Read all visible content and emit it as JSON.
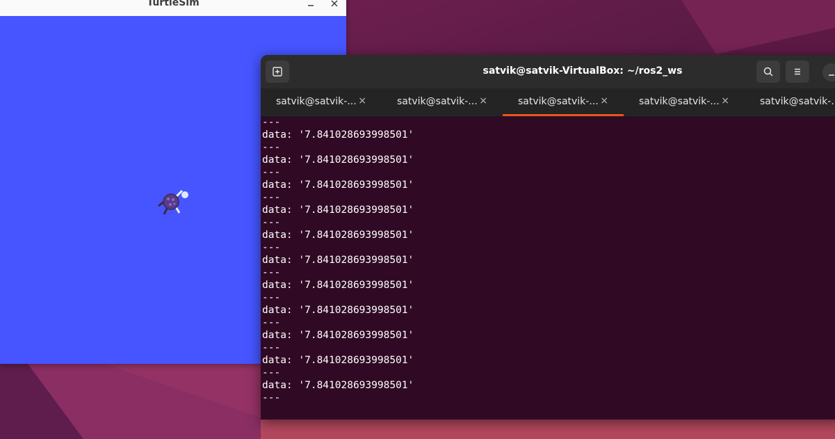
{
  "turtlesim": {
    "title": "TurtleSim",
    "minimize_icon": "minimize-icon",
    "close_icon": "close-icon",
    "background": "#4655ff"
  },
  "terminal": {
    "title": "satvik@satvik-VirtualBox: ~/ros2_ws",
    "background": "#300a24",
    "tabs": [
      {
        "label": "satvik@satvik-...",
        "active": false
      },
      {
        "label": "satvik@satvik-...",
        "active": false
      },
      {
        "label": "satvik@satvik-...",
        "active": true
      },
      {
        "label": "satvik@satvik-...",
        "active": false
      },
      {
        "label": "satvik@satvik-...",
        "active": false
      }
    ],
    "tab_close_glyph": "×",
    "lines": [
      "---",
      "data: '7.841028693998501'",
      "---",
      "data: '7.841028693998501'",
      "---",
      "data: '7.841028693998501'",
      "---",
      "data: '7.841028693998501'",
      "---",
      "data: '7.841028693998501'",
      "---",
      "data: '7.841028693998501'",
      "---",
      "data: '7.841028693998501'",
      "---",
      "data: '7.841028693998501'",
      "---",
      "data: '7.841028693998501'",
      "---",
      "data: '7.841028693998501'",
      "---",
      "data: '7.841028693998501'",
      "---"
    ],
    "accent": "#e95420"
  }
}
